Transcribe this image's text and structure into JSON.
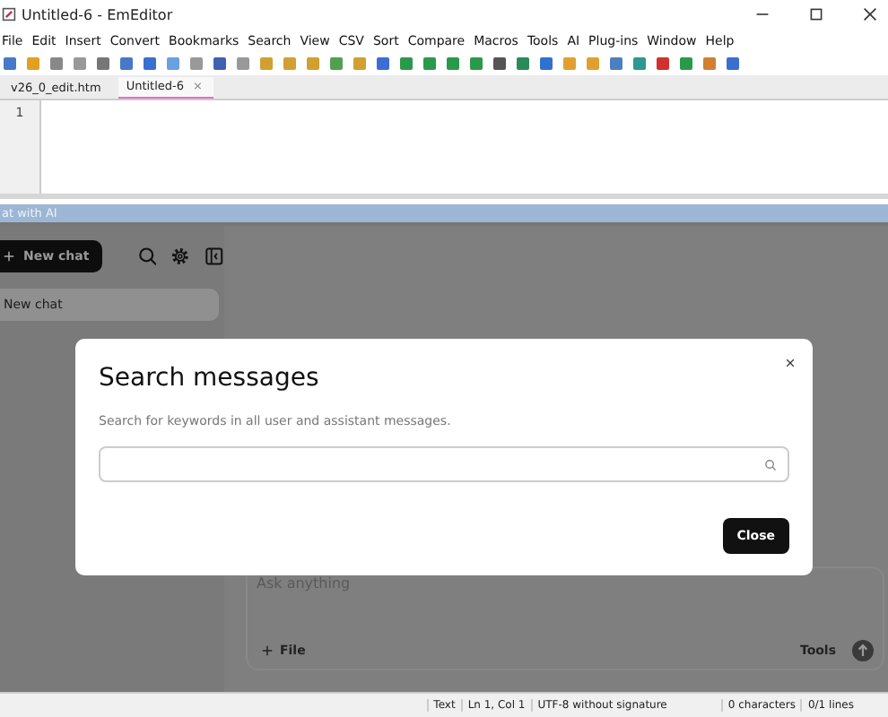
{
  "window": {
    "title": "Untitled-6 - EmEditor"
  },
  "menu": [
    "File",
    "Edit",
    "Insert",
    "Convert",
    "Bookmarks",
    "Search",
    "View",
    "CSV",
    "Sort",
    "Compare",
    "Macros",
    "Tools",
    "AI",
    "Plug-ins",
    "Window",
    "Help"
  ],
  "tabs": [
    {
      "label": "v26_0_edit.htm",
      "selected": false
    },
    {
      "label": "Untitled-6",
      "selected": true,
      "close": "×"
    }
  ],
  "editor": {
    "line_numbers": [
      "1"
    ]
  },
  "panel": {
    "title": "at with AI",
    "new_chat_button": "New chat",
    "chats": [
      {
        "label": "New chat",
        "selected": true
      }
    ],
    "composer": {
      "placeholder": "Ask anything",
      "file_button": "File",
      "tools_button": "Tools"
    }
  },
  "dialog": {
    "title": "Search messages",
    "description": "Search for keywords in all user and assistant messages.",
    "close_button": "Close"
  },
  "status_bar": [
    "Text",
    "Ln 1, Col 1",
    "UTF-8 without signature",
    "0 characters",
    "0/1 lines"
  ]
}
